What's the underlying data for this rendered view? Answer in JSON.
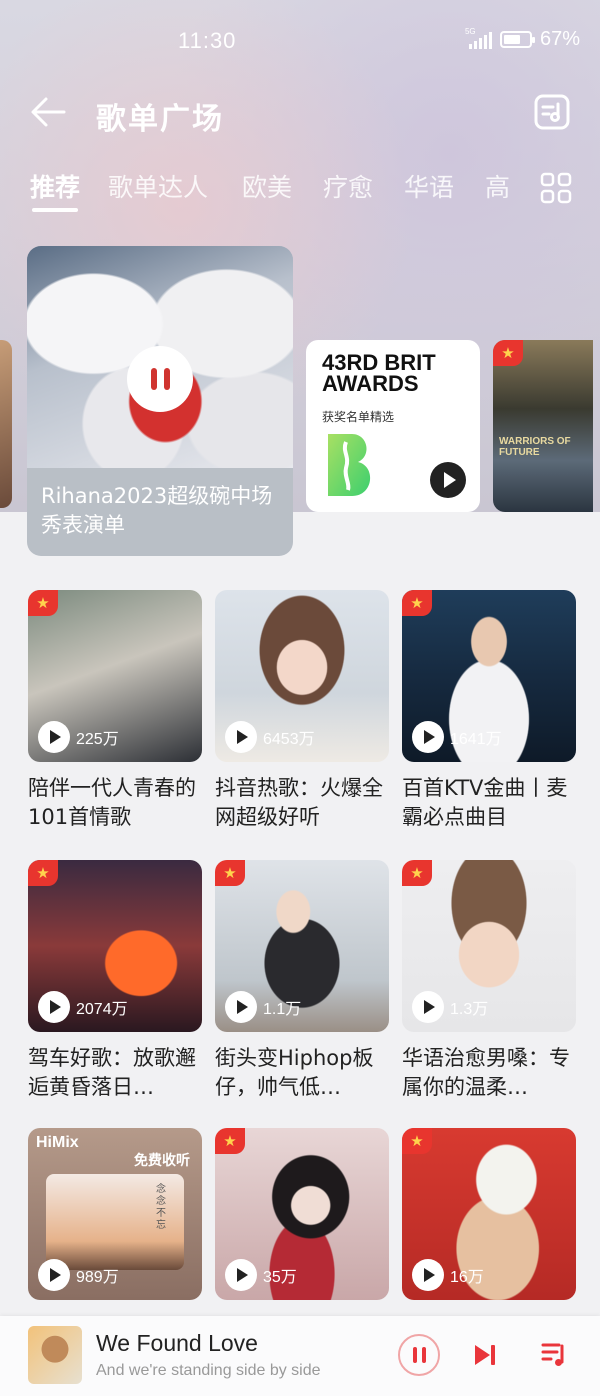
{
  "status": {
    "time": "11:30",
    "network": "5G",
    "battery": "67%",
    "battery_level": 0.67
  },
  "header": {
    "title": "歌单广场"
  },
  "tabs": [
    "推荐",
    "歌单达人",
    "欧美",
    "疗愈",
    "华语",
    "高"
  ],
  "carousel": {
    "feature": {
      "caption": "Rihana2023超级碗中场秀表演单"
    },
    "brit": {
      "title": "43RD BRIT AWARDS",
      "subtitle": "获奖名单精选"
    },
    "movie": {
      "text": "WARRIORS OF FUTURE"
    }
  },
  "playlists": [
    {
      "title": "陪伴一代人青春的101首情歌",
      "count": "225万"
    },
    {
      "title": "抖音热歌：火爆全网超级好听",
      "count": "6453万"
    },
    {
      "title": "百首KTV金曲丨麦霸必点曲目",
      "count": "1641万"
    },
    {
      "title": "驾车好歌：放歌邂逅黄昏落日…",
      "count": "2074万"
    },
    {
      "title": "街头变Hiphop板仔，帅气低…",
      "count": "1.1万"
    },
    {
      "title": "华语治愈男嗓：专属你的温柔…",
      "count": "1.3万"
    },
    {
      "title": "",
      "count": "989万",
      "brand": "HiMix",
      "badge": "免费收听",
      "inner_text": "念念不忘"
    },
    {
      "title": "",
      "count": "35万"
    },
    {
      "title": "",
      "count": "16万"
    }
  ],
  "player": {
    "title": "We Found Love",
    "subtitle": "And we're standing side by side"
  },
  "colors": {
    "accent": "#e9353b",
    "badge": "#e8352e",
    "star": "#ffd34d"
  }
}
